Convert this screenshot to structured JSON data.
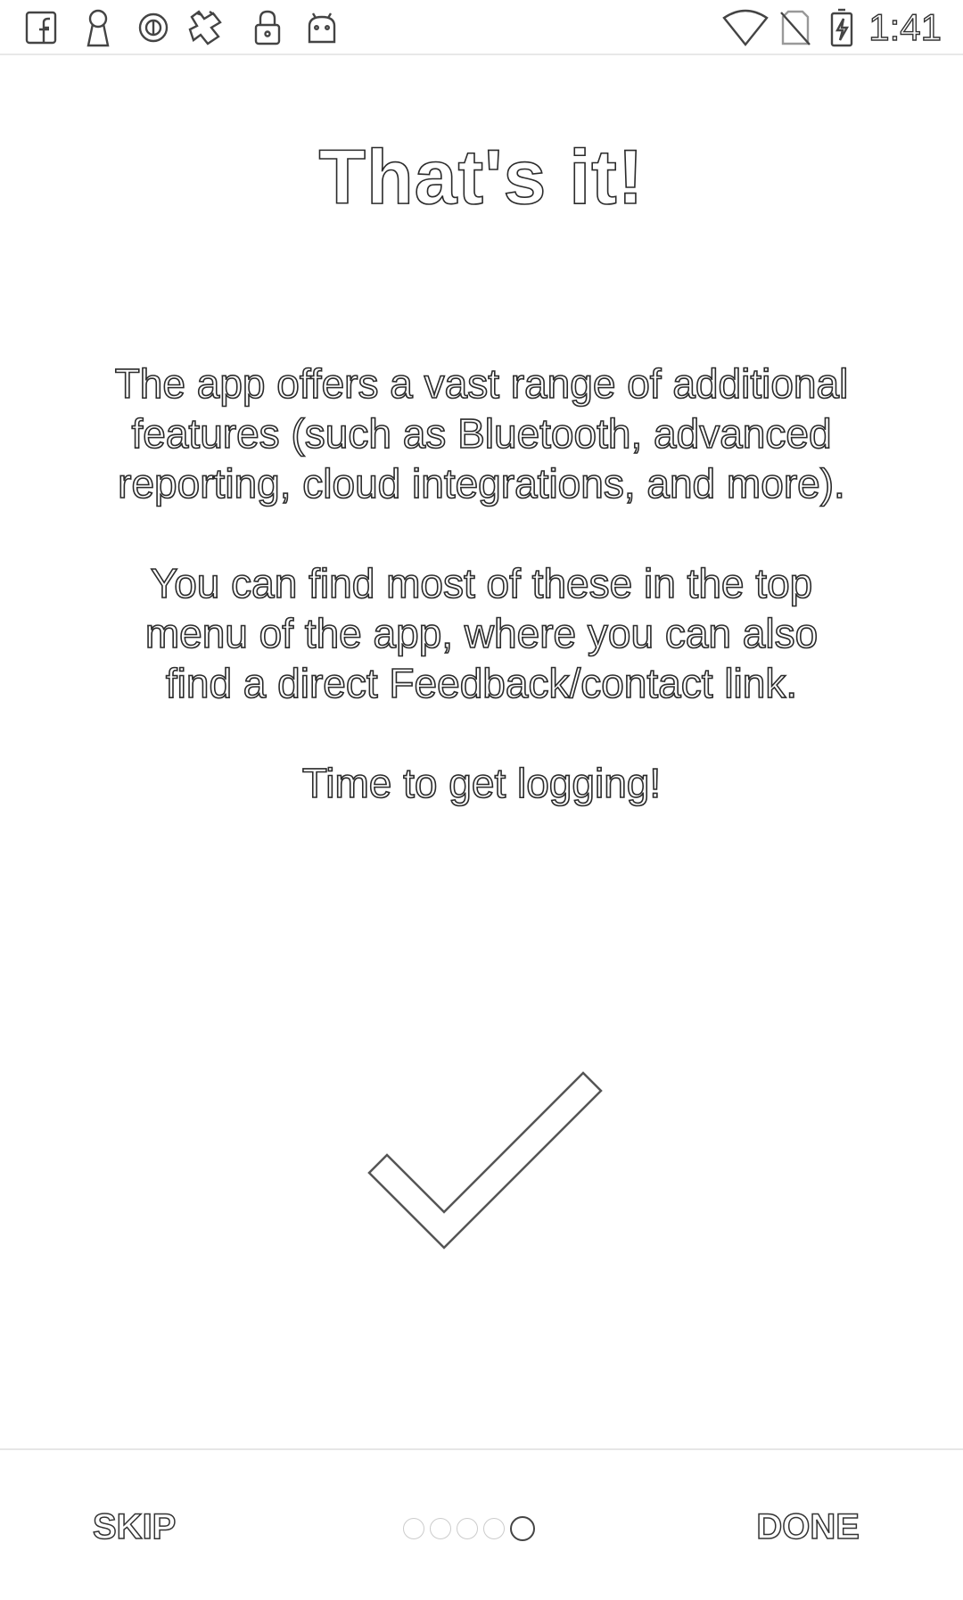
{
  "status_bar": {
    "time": "1:41",
    "left_icons": [
      "facebook-icon",
      "keyhole-icon",
      "circle-letter-icon",
      "fap-gesture-icon",
      "lock-icon",
      "android-robot-icon"
    ],
    "right_icons": [
      "wifi-icon",
      "no-sim-icon",
      "battery-charging-icon"
    ]
  },
  "intro": {
    "title": "That's it!",
    "paragraphs": [
      "The app offers a vast range of additional features (such as Bluetooth, advanced reporting, cloud integrations, and more).",
      "You can find most of these in the top menu of the app, where you can also find a direct Feedback/contact link.",
      "Time to get logging!"
    ],
    "image_icon": "checkmark-icon"
  },
  "footer": {
    "skip_label": "SKIP",
    "done_label": "DONE",
    "page_count": 5,
    "current_page": 5
  }
}
